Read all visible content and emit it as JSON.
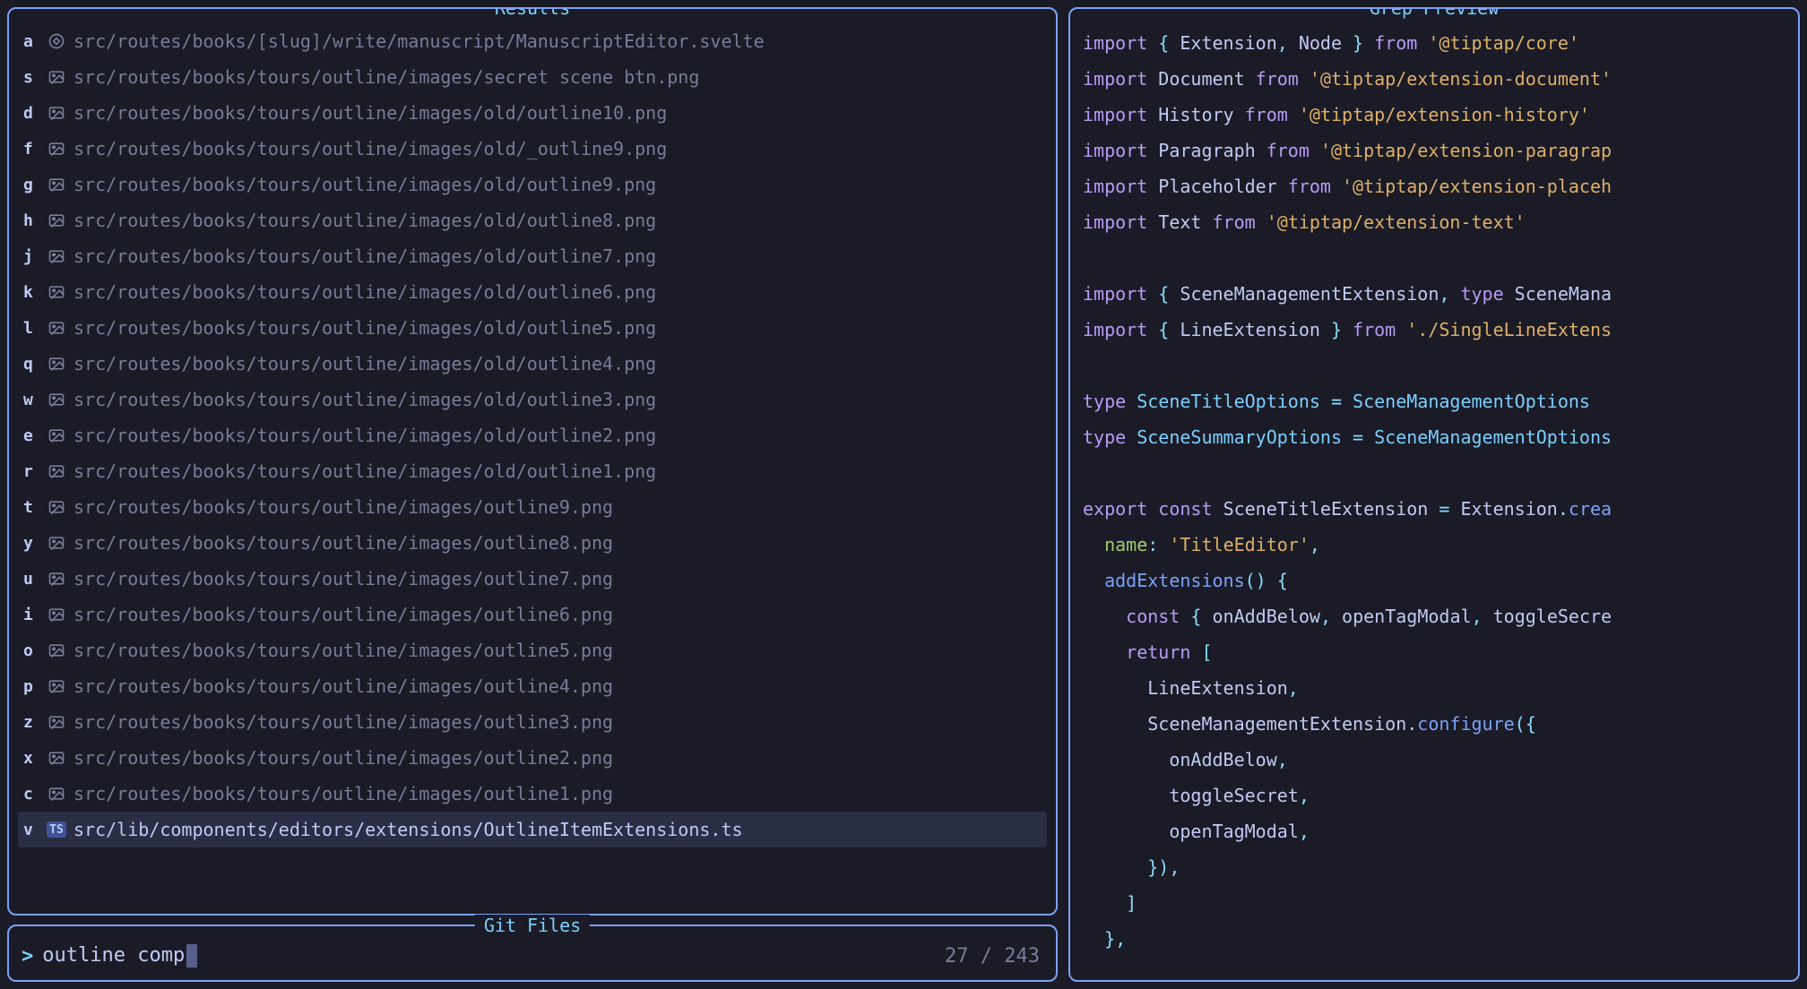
{
  "panels": {
    "results_title": "Results",
    "gitfiles_title": "Git Files",
    "preview_title": "Grep Preview"
  },
  "results": [
    {
      "key": "a",
      "icon": "svelte",
      "path": "src/routes/books/[slug]/write/manuscript/ManuscriptEditor.svelte"
    },
    {
      "key": "s",
      "icon": "image",
      "path": "src/routes/books/tours/outline/images/secret scene btn.png"
    },
    {
      "key": "d",
      "icon": "image",
      "path": "src/routes/books/tours/outline/images/old/outline10.png"
    },
    {
      "key": "f",
      "icon": "image",
      "path": "src/routes/books/tours/outline/images/old/_outline9.png"
    },
    {
      "key": "g",
      "icon": "image",
      "path": "src/routes/books/tours/outline/images/old/outline9.png"
    },
    {
      "key": "h",
      "icon": "image",
      "path": "src/routes/books/tours/outline/images/old/outline8.png"
    },
    {
      "key": "j",
      "icon": "image",
      "path": "src/routes/books/tours/outline/images/old/outline7.png"
    },
    {
      "key": "k",
      "icon": "image",
      "path": "src/routes/books/tours/outline/images/old/outline6.png"
    },
    {
      "key": "l",
      "icon": "image",
      "path": "src/routes/books/tours/outline/images/old/outline5.png"
    },
    {
      "key": "q",
      "icon": "image",
      "path": "src/routes/books/tours/outline/images/old/outline4.png"
    },
    {
      "key": "w",
      "icon": "image",
      "path": "src/routes/books/tours/outline/images/old/outline3.png"
    },
    {
      "key": "e",
      "icon": "image",
      "path": "src/routes/books/tours/outline/images/old/outline2.png"
    },
    {
      "key": "r",
      "icon": "image",
      "path": "src/routes/books/tours/outline/images/old/outline1.png"
    },
    {
      "key": "t",
      "icon": "image",
      "path": "src/routes/books/tours/outline/images/outline9.png"
    },
    {
      "key": "y",
      "icon": "image",
      "path": "src/routes/books/tours/outline/images/outline8.png"
    },
    {
      "key": "u",
      "icon": "image",
      "path": "src/routes/books/tours/outline/images/outline7.png"
    },
    {
      "key": "i",
      "icon": "image",
      "path": "src/routes/books/tours/outline/images/outline6.png"
    },
    {
      "key": "o",
      "icon": "image",
      "path": "src/routes/books/tours/outline/images/outline5.png"
    },
    {
      "key": "p",
      "icon": "image",
      "path": "src/routes/books/tours/outline/images/outline4.png"
    },
    {
      "key": "z",
      "icon": "image",
      "path": "src/routes/books/tours/outline/images/outline3.png"
    },
    {
      "key": "x",
      "icon": "image",
      "path": "src/routes/books/tours/outline/images/outline2.png"
    },
    {
      "key": "c",
      "icon": "image",
      "path": "src/routes/books/tours/outline/images/outline1.png"
    },
    {
      "key": "v",
      "icon": "ts",
      "path": "src/lib/components/editors/extensions/OutlineItemExtensions.ts",
      "selected": true
    }
  ],
  "search": {
    "prompt": ">",
    "query": "outline comp",
    "count_current": "27",
    "count_sep": " / ",
    "count_total": "243"
  },
  "preview_code": [
    [
      [
        "keyword",
        "import"
      ],
      [
        "punc",
        " { "
      ],
      [
        "ident",
        "Extension"
      ],
      [
        "punc",
        ", "
      ],
      [
        "ident",
        "Node"
      ],
      [
        "punc",
        " } "
      ],
      [
        "from",
        "from"
      ],
      [
        "punc",
        " "
      ],
      [
        "string",
        "'@tiptap/core'"
      ]
    ],
    [
      [
        "keyword",
        "import"
      ],
      [
        "punc",
        " "
      ],
      [
        "ident",
        "Document"
      ],
      [
        "punc",
        " "
      ],
      [
        "from",
        "from"
      ],
      [
        "punc",
        " "
      ],
      [
        "string",
        "'@tiptap/extension-document'"
      ]
    ],
    [
      [
        "keyword",
        "import"
      ],
      [
        "punc",
        " "
      ],
      [
        "ident",
        "History"
      ],
      [
        "punc",
        " "
      ],
      [
        "from",
        "from"
      ],
      [
        "punc",
        " "
      ],
      [
        "string",
        "'@tiptap/extension-history'"
      ]
    ],
    [
      [
        "keyword",
        "import"
      ],
      [
        "punc",
        " "
      ],
      [
        "ident",
        "Paragraph"
      ],
      [
        "punc",
        " "
      ],
      [
        "from",
        "from"
      ],
      [
        "punc",
        " "
      ],
      [
        "string",
        "'@tiptap/extension-paragrap"
      ]
    ],
    [
      [
        "keyword",
        "import"
      ],
      [
        "punc",
        " "
      ],
      [
        "ident",
        "Placeholder"
      ],
      [
        "punc",
        " "
      ],
      [
        "from",
        "from"
      ],
      [
        "punc",
        " "
      ],
      [
        "string",
        "'@tiptap/extension-placeh"
      ]
    ],
    [
      [
        "keyword",
        "import"
      ],
      [
        "punc",
        " "
      ],
      [
        "ident",
        "Text"
      ],
      [
        "punc",
        " "
      ],
      [
        "from",
        "from"
      ],
      [
        "punc",
        " "
      ],
      [
        "string",
        "'@tiptap/extension-text'"
      ]
    ],
    [],
    [
      [
        "keyword",
        "import"
      ],
      [
        "punc",
        " { "
      ],
      [
        "ident",
        "SceneManagementExtension"
      ],
      [
        "punc",
        ", "
      ],
      [
        "keyword",
        "type"
      ],
      [
        "punc",
        " "
      ],
      [
        "ident",
        "SceneMana"
      ]
    ],
    [
      [
        "keyword",
        "import"
      ],
      [
        "punc",
        " { "
      ],
      [
        "ident",
        "LineExtension"
      ],
      [
        "punc",
        " } "
      ],
      [
        "from",
        "from"
      ],
      [
        "punc",
        " "
      ],
      [
        "string",
        "'./SingleLineExtens"
      ]
    ],
    [],
    [
      [
        "keyword",
        "type"
      ],
      [
        "punc",
        " "
      ],
      [
        "type",
        "SceneTitleOptions"
      ],
      [
        "punc",
        " = "
      ],
      [
        "type",
        "SceneManagementOptions"
      ]
    ],
    [
      [
        "keyword",
        "type"
      ],
      [
        "punc",
        " "
      ],
      [
        "type",
        "SceneSummaryOptions"
      ],
      [
        "punc",
        " = "
      ],
      [
        "type",
        "SceneManagementOptions"
      ]
    ],
    [],
    [
      [
        "keyword",
        "export"
      ],
      [
        "punc",
        " "
      ],
      [
        "keyword",
        "const"
      ],
      [
        "punc",
        " "
      ],
      [
        "ident",
        "SceneTitleExtension"
      ],
      [
        "punc",
        " = "
      ],
      [
        "ident",
        "Extension"
      ],
      [
        "punc",
        "."
      ],
      [
        "func",
        "crea"
      ]
    ],
    [
      [
        "punc",
        "  "
      ],
      [
        "prop",
        "name"
      ],
      [
        "punc",
        ": "
      ],
      [
        "string",
        "'TitleEditor'"
      ],
      [
        "punc",
        ","
      ]
    ],
    [
      [
        "punc",
        "  "
      ],
      [
        "func",
        "addExtensions"
      ],
      [
        "punc",
        "() {"
      ]
    ],
    [
      [
        "punc",
        "    "
      ],
      [
        "keyword",
        "const"
      ],
      [
        "punc",
        " { "
      ],
      [
        "ident",
        "onAddBelow"
      ],
      [
        "punc",
        ", "
      ],
      [
        "ident",
        "openTagModal"
      ],
      [
        "punc",
        ", "
      ],
      [
        "ident",
        "toggleSecre"
      ]
    ],
    [
      [
        "punc",
        "    "
      ],
      [
        "keyword",
        "return"
      ],
      [
        "punc",
        " ["
      ]
    ],
    [
      [
        "punc",
        "      "
      ],
      [
        "ident",
        "LineExtension"
      ],
      [
        "punc",
        ","
      ]
    ],
    [
      [
        "punc",
        "      "
      ],
      [
        "ident",
        "SceneManagementExtension"
      ],
      [
        "punc",
        "."
      ],
      [
        "func",
        "configure"
      ],
      [
        "punc",
        "({"
      ]
    ],
    [
      [
        "punc",
        "        "
      ],
      [
        "ident",
        "onAddBelow"
      ],
      [
        "punc",
        ","
      ]
    ],
    [
      [
        "punc",
        "        "
      ],
      [
        "ident",
        "toggleSecret"
      ],
      [
        "punc",
        ","
      ]
    ],
    [
      [
        "punc",
        "        "
      ],
      [
        "ident",
        "openTagModal"
      ],
      [
        "punc",
        ","
      ]
    ],
    [
      [
        "punc",
        "      }),"
      ]
    ],
    [
      [
        "punc",
        "    ]"
      ]
    ],
    [
      [
        "punc",
        "  },"
      ]
    ]
  ]
}
